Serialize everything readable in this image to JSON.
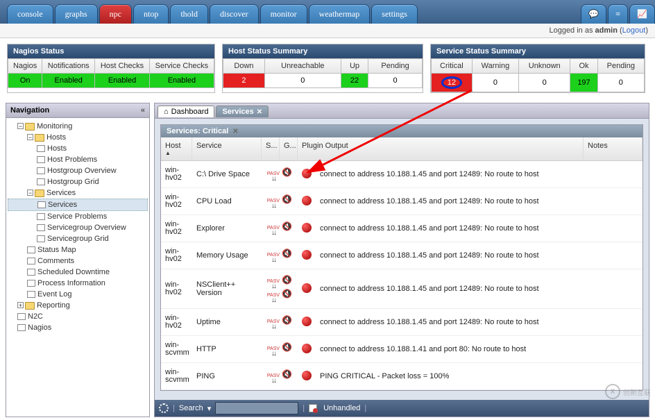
{
  "topnav": {
    "tabs": [
      "console",
      "graphs",
      "npc",
      "ntop",
      "thold",
      "discover",
      "monitor",
      "weathermap",
      "settings"
    ],
    "active": "npc",
    "icon_tabs": [
      "chat",
      "menu",
      "chart"
    ]
  },
  "userbar": {
    "prefix": "Logged in as ",
    "user": "admin",
    "logout": "Logout"
  },
  "nagios_status": {
    "title": "Nagios Status",
    "headers": [
      "Nagios",
      "Notifications",
      "Host Checks",
      "Service Checks"
    ],
    "values": [
      "On",
      "Enabled",
      "Enabled",
      "Enabled"
    ]
  },
  "host_summary": {
    "title": "Host Status Summary",
    "headers": [
      "Down",
      "Unreachable",
      "Up",
      "Pending"
    ],
    "values": [
      "2",
      "0",
      "22",
      "0"
    ],
    "colors": [
      "red",
      "",
      "green",
      ""
    ]
  },
  "service_summary": {
    "title": "Service Status Summary",
    "headers": [
      "Critical",
      "Warning",
      "Unknown",
      "Ok",
      "Pending"
    ],
    "values": [
      "12",
      "0",
      "0",
      "197",
      "0"
    ],
    "colors": [
      "red",
      "",
      "",
      "green",
      ""
    ],
    "ring_index": 0
  },
  "nav": {
    "title": "Navigation",
    "tree": [
      {
        "level": 1,
        "t": "toggle-open",
        "icon": "folder",
        "label": "Monitoring"
      },
      {
        "level": 2,
        "t": "toggle-open",
        "icon": "folder",
        "label": "Hosts"
      },
      {
        "level": 3,
        "icon": "leaf",
        "label": "Hosts"
      },
      {
        "level": 3,
        "icon": "leaf",
        "label": "Host Problems"
      },
      {
        "level": 3,
        "icon": "leaf",
        "label": "Hostgroup Overview"
      },
      {
        "level": 3,
        "icon": "leaf",
        "label": "Hostgroup Grid"
      },
      {
        "level": 2,
        "t": "toggle-open",
        "icon": "folder",
        "label": "Services"
      },
      {
        "level": 3,
        "icon": "leaf",
        "label": "Services",
        "selected": true
      },
      {
        "level": 3,
        "icon": "leaf",
        "label": "Service Problems"
      },
      {
        "level": 3,
        "icon": "leaf",
        "label": "Servicegroup Overview"
      },
      {
        "level": 3,
        "icon": "leaf",
        "label": "Servicegroup Grid"
      },
      {
        "level": 2,
        "icon": "leaf",
        "label": "Status Map"
      },
      {
        "level": 2,
        "icon": "leaf",
        "label": "Comments"
      },
      {
        "level": 2,
        "icon": "leaf",
        "label": "Scheduled Downtime"
      },
      {
        "level": 2,
        "icon": "leaf",
        "label": "Process Information"
      },
      {
        "level": 2,
        "icon": "leaf",
        "label": "Event Log"
      },
      {
        "level": 1,
        "t": "toggle-closed",
        "icon": "folder",
        "label": "Reporting"
      },
      {
        "level": 1,
        "icon": "leaf",
        "label": "N2C"
      },
      {
        "level": 1,
        "icon": "leaf",
        "label": "Nagios"
      }
    ]
  },
  "content": {
    "tabs": [
      {
        "label": "Dashboard",
        "icon": "home"
      },
      {
        "label": "Services",
        "active": true,
        "closable": true
      }
    ],
    "panel_title": "Services: Critical",
    "columns": [
      "Host",
      "Service",
      "S...",
      "G...",
      "Plugin Output",
      "Notes"
    ],
    "rows": [
      {
        "host": "win-hv02",
        "service": "C:\\ Drive Space",
        "output": "connect to address 10.188.1.45 and port 12489: No route to host",
        "double": false
      },
      {
        "host": "win-hv02",
        "service": "CPU Load",
        "output": "connect to address 10.188.1.45 and port 12489: No route to host",
        "double": false
      },
      {
        "host": "win-hv02",
        "service": "Explorer",
        "output": "connect to address 10.188.1.45 and port 12489: No route to host",
        "double": false
      },
      {
        "host": "win-hv02",
        "service": "Memory Usage",
        "output": "connect to address 10.188.1.45 and port 12489: No route to host",
        "double": false
      },
      {
        "host": "win-hv02",
        "service": "NSClient++ Version",
        "output": "connect to address 10.188.1.45 and port 12489: No route to host",
        "double": true
      },
      {
        "host": "win-hv02",
        "service": "Uptime",
        "output": "connect to address 10.188.1.45 and port 12489: No route to host",
        "double": false
      },
      {
        "host": "win-scvmm",
        "service": "HTTP",
        "output": "connect to address 10.188.1.41 and port 80: No route to host",
        "double": false
      },
      {
        "host": "win-scvmm",
        "service": "PING",
        "output": "PING CRITICAL - Packet loss = 100%",
        "double": false
      }
    ]
  },
  "bottombar": {
    "search_label": "Search",
    "unhandled": "Unhandled"
  },
  "watermark": {
    "brand": "创新互联"
  }
}
